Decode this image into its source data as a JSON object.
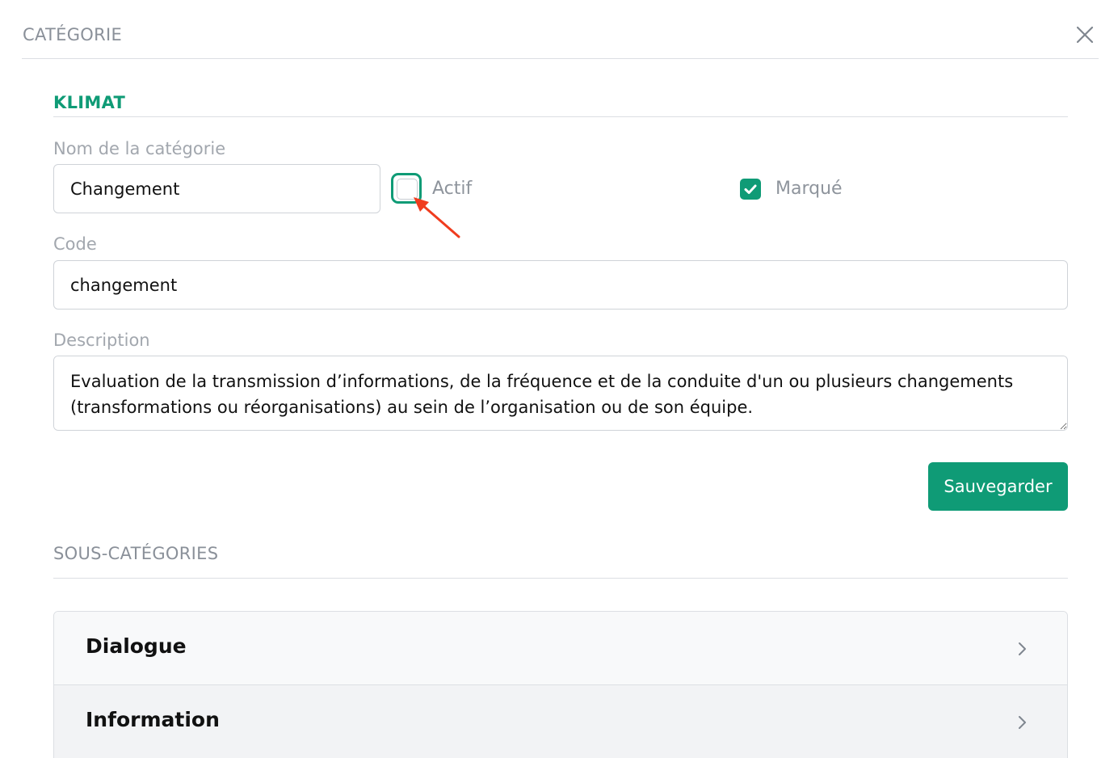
{
  "modal": {
    "title": "CATÉGORIE",
    "close_icon": "close-icon"
  },
  "section": {
    "title": "KLIMAT"
  },
  "fields": {
    "name_label": "Nom de la catégorie",
    "name_value": "Changement",
    "actif_label": "Actif",
    "actif_checked": false,
    "marque_label": "Marqué",
    "marque_checked": true,
    "code_label": "Code",
    "code_value": "changement",
    "description_label": "Description",
    "description_value": "Evaluation de la transmission d’informations, de la fréquence et de la conduite d'un ou plusieurs changements (transformations ou réorganisations) au sein de l’organisation ou de son équipe."
  },
  "actions": {
    "save_label": "Sauvegarder"
  },
  "subcategories": {
    "title": "SOUS-CATÉGORIES",
    "items": [
      {
        "label": "Dialogue"
      },
      {
        "label": "Information"
      }
    ]
  },
  "colors": {
    "accent": "#0f9b76",
    "annotation": "#f03c1e"
  }
}
